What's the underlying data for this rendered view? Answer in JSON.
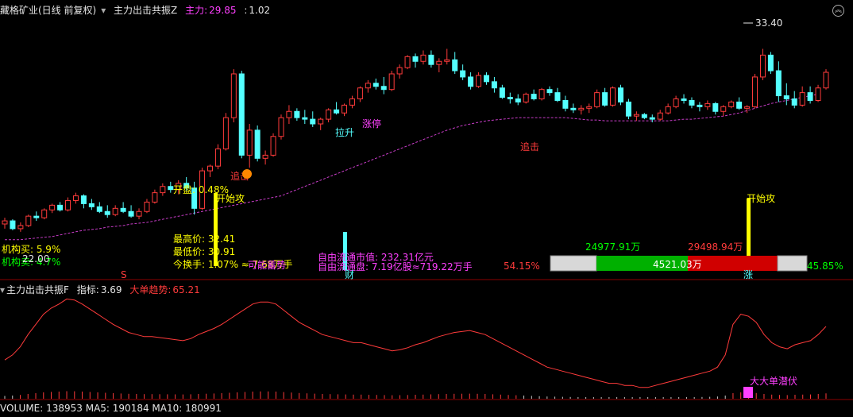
{
  "header1": {
    "stock_title": "藏格矿业(日线 前复权)",
    "indicator_name": "主力出击共振Z",
    "main_label": "主力:",
    "main_value": "29.85",
    "sep": ":",
    "ratio_value": "1.02"
  },
  "header2": {
    "indicator_name": "主力出击共振F",
    "metric_label": "指标:",
    "metric_value": "3.69",
    "big_order_label": "大单趋势:",
    "big_order_value": "65.21"
  },
  "header3": {
    "volume_text": "VOLUME: 138953 MA5: 190184 MA10: 180991"
  },
  "annotations": {
    "high_price": "33.40",
    "open_label": "开盘: 0.48%",
    "high_label": "最高价: 32.41",
    "low_label": "最低价: 30.91",
    "turnover_label": "今换手: 1.07% ≈ 7.68万手",
    "inst_buy": "机构买: 5.9%",
    "inst_sell": "机构卖: 4.7%",
    "price_22": "22.00",
    "free_cap": "自由流通市值: 232.31亿元",
    "free_float": "自由流通盘: 7.19亿股≈719.22万手",
    "pct_left": "54.15%",
    "pct_right": "45.85%",
    "bar_left": "24977.91万",
    "bar_right": "29498.94万",
    "bar_center": "4521.03万",
    "start_attack_1": "开始攻",
    "start_attack_2": "开始攻",
    "chase_1": "追击",
    "chase_2": "追击",
    "pullback": "拉升",
    "limit_up": "涨停",
    "accumulate": "可能蓄势",
    "fin": "财",
    "rise": "涨",
    "big_order_hidden": "大大单潜伏",
    "s_mark": "S"
  },
  "colors": {
    "up": "#ff3b3b",
    "down": "#54ffff",
    "ma": "#c83cc8",
    "yellow": "#ffff00",
    "magenta": "#ff40ff",
    "green": "#00ff00",
    "red_bar": "#ff0000"
  },
  "chart_data": {
    "type": "candlestick",
    "ylim": [
      19,
      35
    ],
    "candles": [
      [
        22.2,
        22.6,
        21.9,
        22.4
      ],
      [
        22.4,
        22.5,
        21.8,
        21.9
      ],
      [
        21.9,
        22.3,
        21.7,
        22.1
      ],
      [
        22.1,
        22.8,
        22.0,
        22.7
      ],
      [
        22.7,
        23.0,
        22.4,
        22.6
      ],
      [
        22.6,
        23.2,
        22.5,
        23.1
      ],
      [
        23.1,
        23.5,
        22.9,
        23.4
      ],
      [
        23.4,
        23.6,
        23.0,
        23.1
      ],
      [
        23.1,
        23.9,
        23.0,
        23.7
      ],
      [
        23.7,
        24.2,
        23.5,
        24.0
      ],
      [
        24.0,
        24.1,
        23.2,
        23.5
      ],
      [
        23.5,
        23.8,
        23.1,
        23.3
      ],
      [
        23.3,
        23.6,
        22.9,
        23.0
      ],
      [
        23.0,
        23.4,
        22.6,
        22.8
      ],
      [
        22.8,
        23.4,
        22.7,
        23.2
      ],
      [
        23.2,
        23.6,
        22.9,
        23.0
      ],
      [
        23.0,
        23.4,
        22.6,
        22.7
      ],
      [
        22.7,
        23.2,
        22.5,
        23.0
      ],
      [
        23.0,
        23.8,
        22.9,
        23.6
      ],
      [
        23.6,
        24.4,
        23.5,
        24.2
      ],
      [
        24.2,
        24.8,
        24.0,
        24.6
      ],
      [
        24.6,
        24.9,
        24.2,
        24.4
      ],
      [
        24.4,
        25.0,
        24.1,
        24.8
      ],
      [
        24.8,
        25.2,
        24.3,
        24.5
      ],
      [
        24.5,
        24.9,
        22.8,
        23.2
      ],
      [
        23.2,
        25.8,
        23.1,
        25.6
      ],
      [
        25.6,
        26.0,
        25.2,
        25.9
      ],
      [
        25.9,
        27.3,
        25.7,
        27.0
      ],
      [
        27.0,
        29.3,
        26.9,
        29.0
      ],
      [
        29.0,
        32.1,
        28.7,
        31.8
      ],
      [
        31.8,
        32.0,
        26.4,
        26.6
      ],
      [
        26.6,
        28.6,
        25.8,
        28.2
      ],
      [
        28.2,
        28.5,
        26.2,
        26.4
      ],
      [
        26.4,
        26.9,
        26.0,
        26.6
      ],
      [
        26.6,
        28.0,
        26.5,
        27.8
      ],
      [
        27.8,
        29.2,
        27.6,
        29.0
      ],
      [
        29.0,
        29.8,
        28.6,
        29.4
      ],
      [
        29.4,
        29.6,
        28.8,
        29.0
      ],
      [
        29.0,
        29.5,
        28.6,
        28.9
      ],
      [
        28.9,
        29.4,
        28.4,
        28.6
      ],
      [
        28.6,
        29.0,
        28.2,
        28.9
      ],
      [
        28.9,
        29.6,
        28.7,
        29.5
      ],
      [
        29.5,
        30.0,
        29.2,
        29.3
      ],
      [
        29.3,
        29.9,
        29.1,
        29.8
      ],
      [
        29.8,
        30.4,
        29.6,
        30.2
      ],
      [
        30.2,
        31.0,
        30.0,
        30.9
      ],
      [
        30.9,
        31.4,
        30.6,
        31.2
      ],
      [
        31.2,
        31.5,
        30.8,
        31.0
      ],
      [
        31.0,
        31.6,
        30.5,
        30.8
      ],
      [
        30.8,
        32.0,
        30.7,
        31.8
      ],
      [
        31.8,
        32.4,
        31.5,
        32.2
      ],
      [
        32.2,
        33.0,
        32.1,
        32.9
      ],
      [
        32.9,
        33.1,
        32.2,
        32.6
      ],
      [
        32.6,
        33.3,
        32.4,
        33.0
      ],
      [
        33.0,
        33.3,
        32.2,
        32.4
      ],
      [
        32.4,
        32.8,
        31.9,
        32.6
      ],
      [
        32.6,
        33.4,
        32.4,
        32.7
      ],
      [
        32.7,
        33.2,
        31.8,
        32.0
      ],
      [
        32.0,
        32.4,
        31.4,
        31.6
      ],
      [
        31.6,
        31.9,
        30.8,
        31.0
      ],
      [
        31.0,
        31.9,
        30.9,
        31.7
      ],
      [
        31.7,
        31.9,
        31.1,
        31.3
      ],
      [
        31.3,
        31.6,
        30.6,
        30.9
      ],
      [
        30.9,
        31.1,
        30.2,
        30.3
      ],
      [
        30.3,
        30.6,
        29.9,
        30.2
      ],
      [
        30.2,
        30.5,
        29.8,
        30.0
      ],
      [
        30.0,
        30.6,
        29.9,
        30.5
      ],
      [
        30.5,
        30.8,
        30.1,
        30.2
      ],
      [
        30.2,
        30.9,
        30.1,
        30.8
      ],
      [
        30.8,
        31.0,
        30.4,
        30.6
      ],
      [
        30.6,
        30.9,
        30.0,
        30.1
      ],
      [
        30.1,
        30.4,
        29.4,
        29.6
      ],
      [
        29.6,
        29.9,
        29.3,
        29.5
      ],
      [
        29.5,
        29.8,
        29.2,
        29.6
      ],
      [
        29.6,
        29.9,
        29.3,
        29.7
      ],
      [
        29.7,
        30.8,
        29.6,
        30.6
      ],
      [
        30.6,
        30.9,
        29.7,
        29.8
      ],
      [
        29.8,
        31.0,
        29.7,
        30.9
      ],
      [
        30.9,
        31.1,
        29.8,
        30.0
      ],
      [
        30.0,
        30.2,
        28.9,
        29.1
      ],
      [
        29.1,
        29.4,
        28.8,
        29.2
      ],
      [
        29.2,
        29.3,
        28.9,
        29.0
      ],
      [
        29.0,
        29.2,
        28.7,
        28.9
      ],
      [
        28.9,
        29.5,
        28.8,
        29.3
      ],
      [
        29.3,
        29.9,
        29.2,
        29.7
      ],
      [
        29.7,
        30.4,
        29.6,
        30.2
      ],
      [
        30.2,
        30.5,
        29.9,
        30.1
      ],
      [
        30.1,
        30.3,
        29.6,
        29.8
      ],
      [
        29.8,
        30.0,
        29.4,
        29.7
      ],
      [
        29.7,
        30.1,
        29.5,
        29.9
      ],
      [
        29.9,
        30.0,
        29.2,
        29.4
      ],
      [
        29.4,
        29.8,
        29.1,
        29.7
      ],
      [
        29.7,
        30.1,
        29.6,
        30.0
      ],
      [
        30.0,
        30.3,
        29.5,
        29.6
      ],
      [
        29.6,
        29.8,
        29.3,
        29.7
      ],
      [
        29.7,
        31.8,
        29.6,
        31.6
      ],
      [
        31.6,
        33.4,
        31.4,
        33.0
      ],
      [
        33.0,
        33.2,
        31.8,
        32.0
      ],
      [
        32.0,
        32.6,
        30.0,
        30.4
      ],
      [
        30.4,
        31.2,
        29.8,
        30.2
      ],
      [
        30.2,
        30.7,
        29.6,
        29.8
      ],
      [
        29.8,
        31.0,
        29.7,
        30.6
      ],
      [
        30.6,
        31.0,
        29.9,
        30.1
      ],
      [
        30.1,
        31.1,
        30.0,
        30.9
      ],
      [
        30.9,
        32.1,
        30.8,
        31.9
      ]
    ],
    "ma": [
      21.2,
      21.2,
      21.2,
      21.25,
      21.3,
      21.35,
      21.4,
      21.5,
      21.6,
      21.7,
      21.8,
      21.85,
      21.9,
      22.0,
      22.05,
      22.1,
      22.2,
      22.25,
      22.3,
      22.4,
      22.5,
      22.6,
      22.7,
      22.8,
      22.9,
      23.0,
      23.1,
      23.2,
      23.3,
      23.4,
      23.5,
      23.6,
      23.7,
      23.8,
      23.9,
      24.0,
      24.2,
      24.4,
      24.6,
      24.8,
      25.0,
      25.2,
      25.4,
      25.6,
      25.8,
      26.0,
      26.2,
      26.4,
      26.6,
      26.8,
      27.0,
      27.2,
      27.4,
      27.6,
      27.8,
      28.0,
      28.2,
      28.35,
      28.5,
      28.6,
      28.7,
      28.8,
      28.85,
      28.9,
      28.95,
      29.0,
      29.0,
      29.0,
      29.0,
      29.0,
      29.0,
      29.0,
      28.95,
      28.9,
      28.85,
      28.85,
      28.8,
      28.8,
      28.8,
      28.8,
      28.8,
      28.8,
      28.8,
      28.8,
      28.8,
      28.85,
      28.9,
      28.9,
      28.95,
      29.0,
      29.05,
      29.1,
      29.2,
      29.3,
      29.45,
      29.6,
      29.75,
      29.9,
      30.0,
      30.1,
      30.2,
      30.3,
      30.4,
      30.5
    ],
    "indicator_line": [
      35,
      40,
      48,
      60,
      70,
      80,
      86,
      90,
      95,
      94,
      90,
      85,
      80,
      75,
      70,
      66,
      62,
      60,
      58,
      58,
      57,
      56,
      55,
      54,
      56,
      60,
      63,
      66,
      70,
      75,
      80,
      85,
      90,
      92,
      92,
      90,
      84,
      78,
      72,
      68,
      64,
      60,
      58,
      56,
      54,
      52,
      52,
      50,
      48,
      46,
      44,
      45,
      47,
      50,
      52,
      55,
      58,
      60,
      62,
      63,
      64,
      62,
      60,
      56,
      52,
      48,
      44,
      40,
      36,
      32,
      28,
      26,
      24,
      22,
      20,
      18,
      16,
      14,
      12,
      12,
      10,
      10,
      8,
      8,
      10,
      12,
      14,
      16,
      18,
      20,
      22,
      24,
      28,
      40,
      70,
      80,
      78,
      72,
      60,
      52,
      48,
      46,
      50,
      52,
      54,
      60,
      68
    ],
    "indicator_ylim": [
      0,
      100
    ]
  }
}
